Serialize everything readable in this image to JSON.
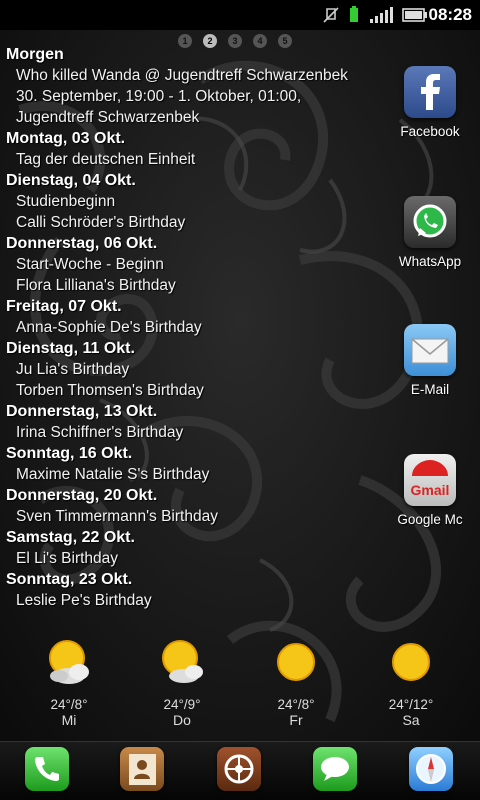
{
  "status_bar": {
    "time": "08:28"
  },
  "page_indicator": {
    "pages": [
      "1",
      "2",
      "3",
      "4",
      "5"
    ],
    "active_index": 1
  },
  "agenda": [
    {
      "header": "Morgen",
      "events": [
        "Who killed Wanda @ Jugendtreff Schwarzenbek",
        "30. September, 19:00 - 1. Oktober, 01:00,",
        "Jugendtreff Schwarzenbek"
      ]
    },
    {
      "header": "Montag, 03 Okt.",
      "events": [
        "Tag der deutschen Einheit"
      ]
    },
    {
      "header": "Dienstag, 04 Okt.",
      "events": [
        "Studienbeginn",
        "Calli Schröder's Birthday"
      ]
    },
    {
      "header": "Donnerstag, 06 Okt.",
      "events": [
        "Start-Woche - Beginn",
        "Flora Lilliana's Birthday"
      ]
    },
    {
      "header": "Freitag, 07 Okt.",
      "events": [
        "Anna-Sophie De's Birthday"
      ]
    },
    {
      "header": "Dienstag, 11 Okt.",
      "events": [
        "Ju Lia's Birthday",
        "Torben Thomsen's Birthday"
      ]
    },
    {
      "header": "Donnerstag, 13 Okt.",
      "events": [
        "Irina Schiffner's Birthday"
      ]
    },
    {
      "header": "Sonntag, 16 Okt.",
      "events": [
        "Maxime Natalie S's Birthday"
      ]
    },
    {
      "header": "Donnerstag, 20 Okt.",
      "events": [
        "Sven Timmermann's Birthday"
      ]
    },
    {
      "header": "Samstag, 22 Okt.",
      "events": [
        "El Li's Birthday"
      ]
    },
    {
      "header": "Sonntag, 23 Okt.",
      "events": [
        "Leslie Pe's Birthday"
      ]
    }
  ],
  "apps": [
    {
      "name": "facebook",
      "label": "Facebook"
    },
    {
      "name": "whatsapp",
      "label": "WhatsApp"
    },
    {
      "name": "email",
      "label": "E-Mail"
    },
    {
      "name": "gmail",
      "label": "Google Mc"
    }
  ],
  "weather": [
    {
      "temp": "24°/8°",
      "day": "Mi",
      "icon": "sun-cloud-icon"
    },
    {
      "temp": "24°/9°",
      "day": "Do",
      "icon": "sun-cloud-icon"
    },
    {
      "temp": "24°/8°",
      "day": "Fr",
      "icon": "sun-icon"
    },
    {
      "temp": "24°/12°",
      "day": "Sa",
      "icon": "sun-icon"
    }
  ],
  "dock": [
    "phone-icon",
    "contacts-icon",
    "app-drawer-icon",
    "messages-icon",
    "browser-icon"
  ],
  "colors": {
    "facebook": "#3b5998",
    "whatsapp": "#2fb84a",
    "email": "#5aa9e6",
    "gmail": "#d0d0d0",
    "sun": "#f5c518"
  }
}
